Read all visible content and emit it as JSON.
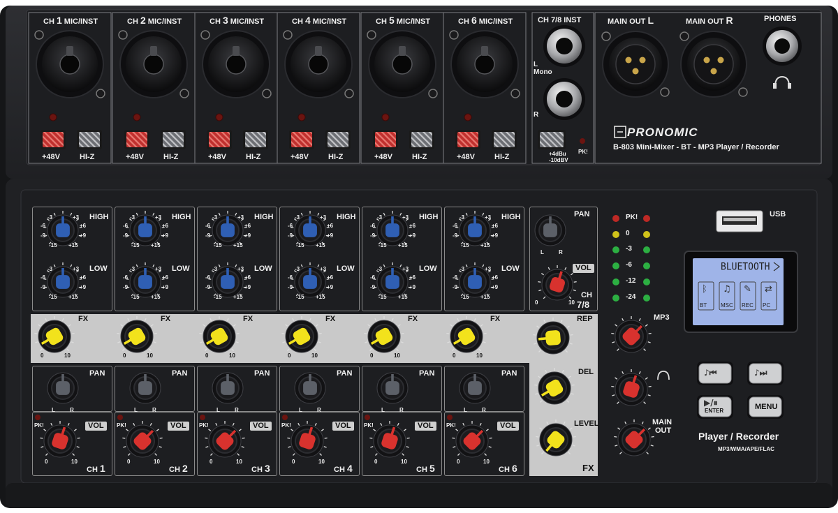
{
  "top": {
    "channels": [
      {
        "num": "1",
        "label": "MIC/INST",
        "phantom": "+48V",
        "hiz": "HI-Z"
      },
      {
        "num": "2",
        "label": "MIC/INST",
        "phantom": "+48V",
        "hiz": "HI-Z"
      },
      {
        "num": "3",
        "label": "MIC/INST",
        "phantom": "+48V",
        "hiz": "HI-Z"
      },
      {
        "num": "4",
        "label": "MIC/INST",
        "phantom": "+48V",
        "hiz": "HI-Z"
      },
      {
        "num": "5",
        "label": "MIC/INST",
        "phantom": "+48V",
        "hiz": "HI-Z"
      },
      {
        "num": "6",
        "label": "MIC/INST",
        "phantom": "+48V",
        "hiz": "HI-Z"
      }
    ],
    "ch78": {
      "title": "CH 7/8 INST",
      "l": "L",
      "mono": "Mono",
      "r": "R",
      "gain_hi": "+4dBu",
      "gain_lo": "-10dBV",
      "pk": "PK!"
    },
    "main_l": {
      "text": "MAIN OUT",
      "side": "L"
    },
    "main_r": {
      "text": "MAIN OUT",
      "side": "R"
    },
    "phones": "PHONES",
    "brand": "PRONOMIC",
    "model": "B-803 Mini-Mixer - BT - MP3 Player / Recorder"
  },
  "strip": {
    "high": "HIGH",
    "low": "LOW",
    "fx": "FX",
    "pan": "PAN",
    "vol": "VOL",
    "pk": "PK!",
    "tick_0": "0",
    "tick_p3": "+3",
    "tick_m3": "-3",
    "tick_p6": "+6",
    "tick_m6": "-6",
    "tick_p9": "+9",
    "tick_m9": "-9",
    "tick_p15": "+15",
    "tick_m15": "-15",
    "fx_min": "0",
    "fx_max": "10",
    "pan_l": "L",
    "pan_r": "R",
    "ch_prefix": "CH",
    "channels": [
      "1",
      "2",
      "3",
      "4",
      "5",
      "6"
    ]
  },
  "ch78_strip": {
    "pan": "PAN",
    "l": "L",
    "r": "R",
    "vol": "VOL",
    "ch": "CH",
    "num": "7/8",
    "min": "0",
    "max": "10"
  },
  "fx_section": {
    "rep": "REP",
    "del": "DEL",
    "level": "LEVEL",
    "title": "FX"
  },
  "meter": {
    "labels": [
      "PK!",
      "0",
      "-3",
      "-6",
      "-12",
      "-24"
    ]
  },
  "master": {
    "mp3": "MP3",
    "main_out_1": "MAIN",
    "main_out_2": "OUT"
  },
  "usb": "USB",
  "lcd": {
    "title": "BLUETOOTH",
    "modes": [
      {
        "icon": "bluetooth-icon",
        "text": "BT"
      },
      {
        "icon": "music-note-icon",
        "text": "MSC"
      },
      {
        "icon": "microphone-icon",
        "text": "REC"
      },
      {
        "icon": "usb-icon",
        "text": "PC"
      }
    ]
  },
  "player": {
    "enter": "ENTER",
    "menu": "MENU",
    "title": "Player / Recorder",
    "formats": "MP3/WMA/APE/FLAC"
  },
  "colors": {
    "body": "#2a2b2e",
    "panel": "#1d1e21",
    "knob_blue": "#2f5fb4",
    "knob_yellow": "#f2e21c",
    "knob_red": "#d8322e",
    "knob_gray": "#5c6068",
    "button_red": "#c0302e",
    "lcd": "#9fb4e8",
    "fx_band": "#c9c9c9"
  }
}
